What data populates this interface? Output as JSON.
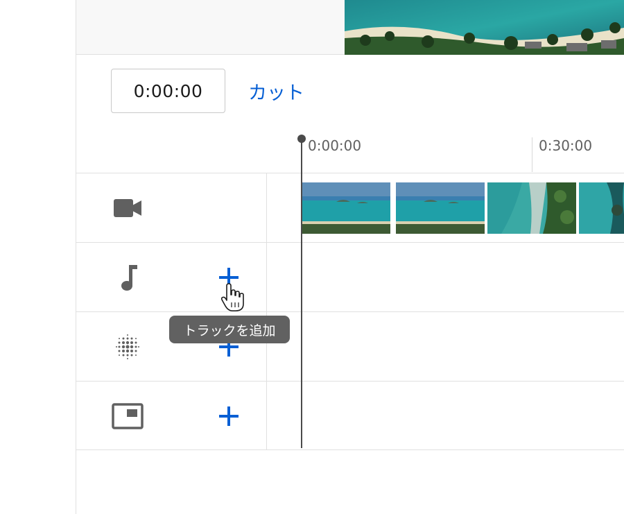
{
  "editor": {
    "timecode": "0:00:00",
    "cut_label": "カット"
  },
  "ruler": {
    "labels": [
      "0:00:00",
      "0:30:00"
    ]
  },
  "tracks": [
    {
      "type": "video",
      "icon": "video-camera-icon"
    },
    {
      "type": "audio",
      "icon": "music-note-icon",
      "add": "plus-icon"
    },
    {
      "type": "blur",
      "icon": "blur-dots-icon",
      "add": "plus-icon"
    },
    {
      "type": "end-screen",
      "icon": "end-screen-icon",
      "add": "plus-icon"
    }
  ],
  "tooltip": {
    "text": "トラックを追加"
  },
  "colors": {
    "accent": "#065fd4",
    "icon": "#606060",
    "tooltip_bg": "#616161"
  }
}
